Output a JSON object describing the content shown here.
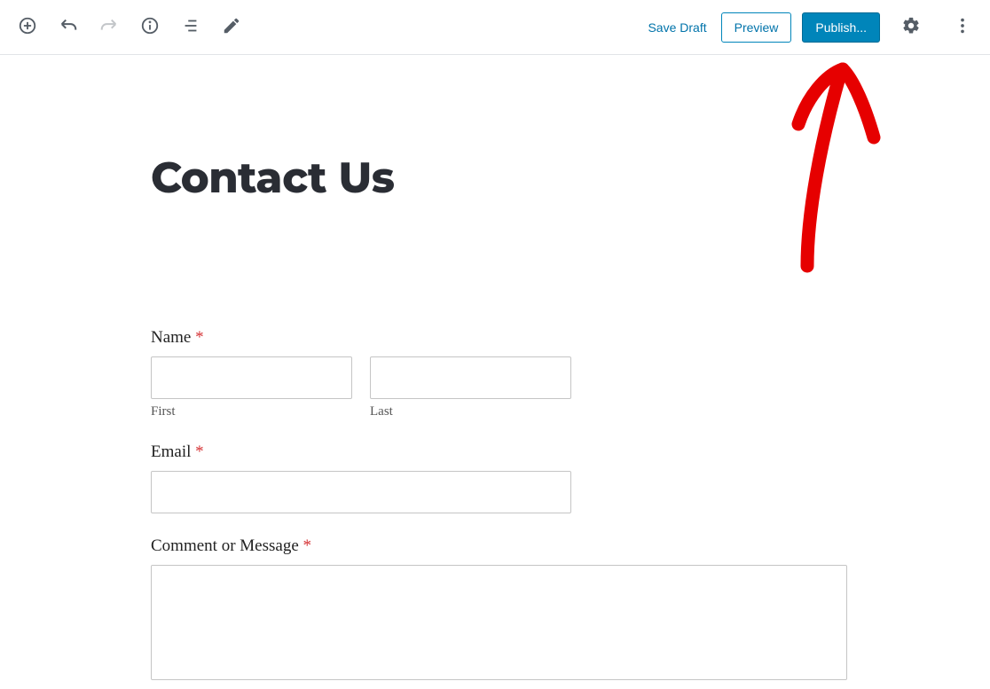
{
  "toolbar": {
    "save_draft_label": "Save Draft",
    "preview_label": "Preview",
    "publish_label": "Publish..."
  },
  "page": {
    "title": "Contact Us"
  },
  "form": {
    "name": {
      "label": "Name ",
      "first_sublabel": "First",
      "last_sublabel": "Last"
    },
    "email": {
      "label": "Email "
    },
    "comment": {
      "label": "Comment or Message "
    },
    "required_mark": "*"
  }
}
